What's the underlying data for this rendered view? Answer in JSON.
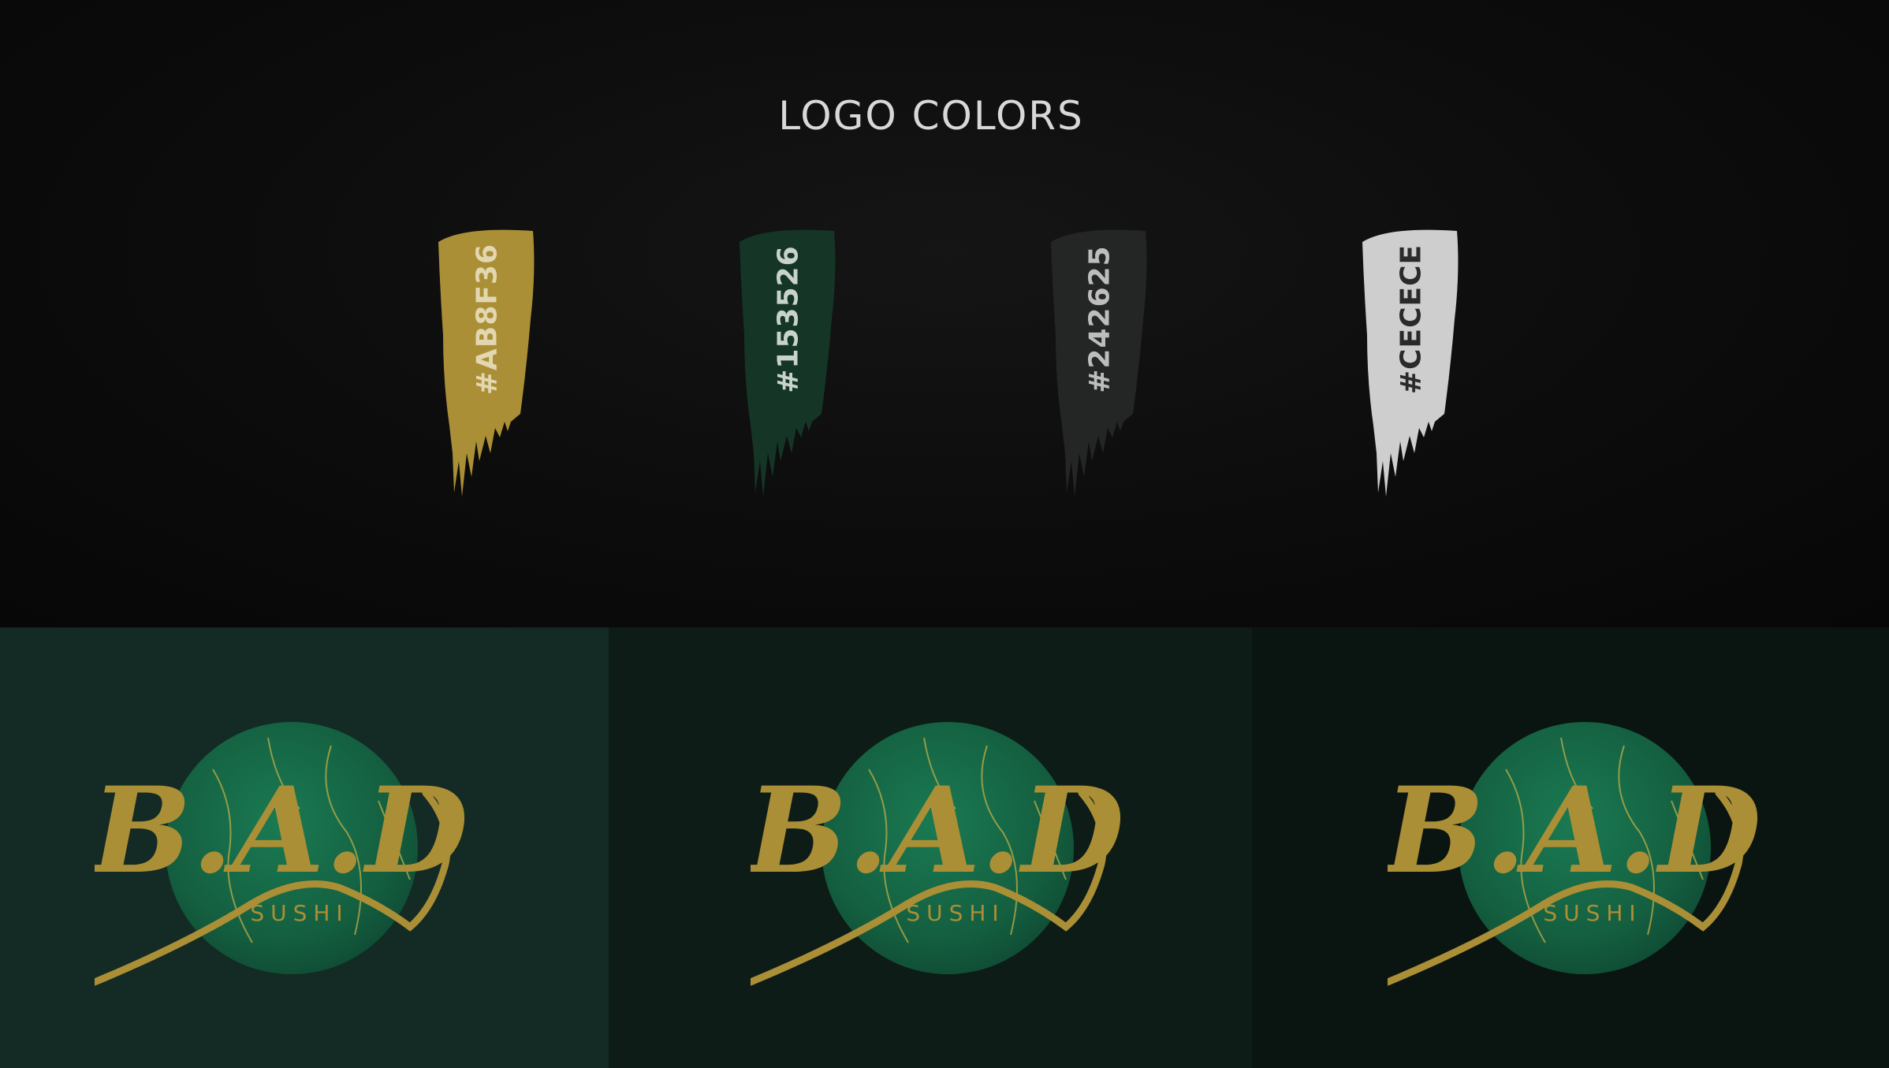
{
  "title": "LOGO COLORS",
  "swatches": [
    {
      "hex": "#AB8F36",
      "color": "#AB8F36",
      "text_color": "#e2d7b0"
    },
    {
      "hex": "#153526",
      "color": "#153526",
      "text_color": "#c9d3cd"
    },
    {
      "hex": "#242625",
      "color": "#242625",
      "text_color": "#bdbdbd"
    },
    {
      "hex": "#CECECE",
      "color": "#CECECE",
      "text_color": "#2a2a2a"
    }
  ],
  "panels": [
    {
      "background": "#132b24"
    },
    {
      "background": "#0e1c18"
    },
    {
      "background": "#0a1511"
    }
  ],
  "logo": {
    "letters": "B.A.D",
    "subtitle": "SUSHI",
    "gold": "#AB8F36",
    "circle_color": "#1a7a52",
    "circle_dark": "#0f4a33"
  }
}
